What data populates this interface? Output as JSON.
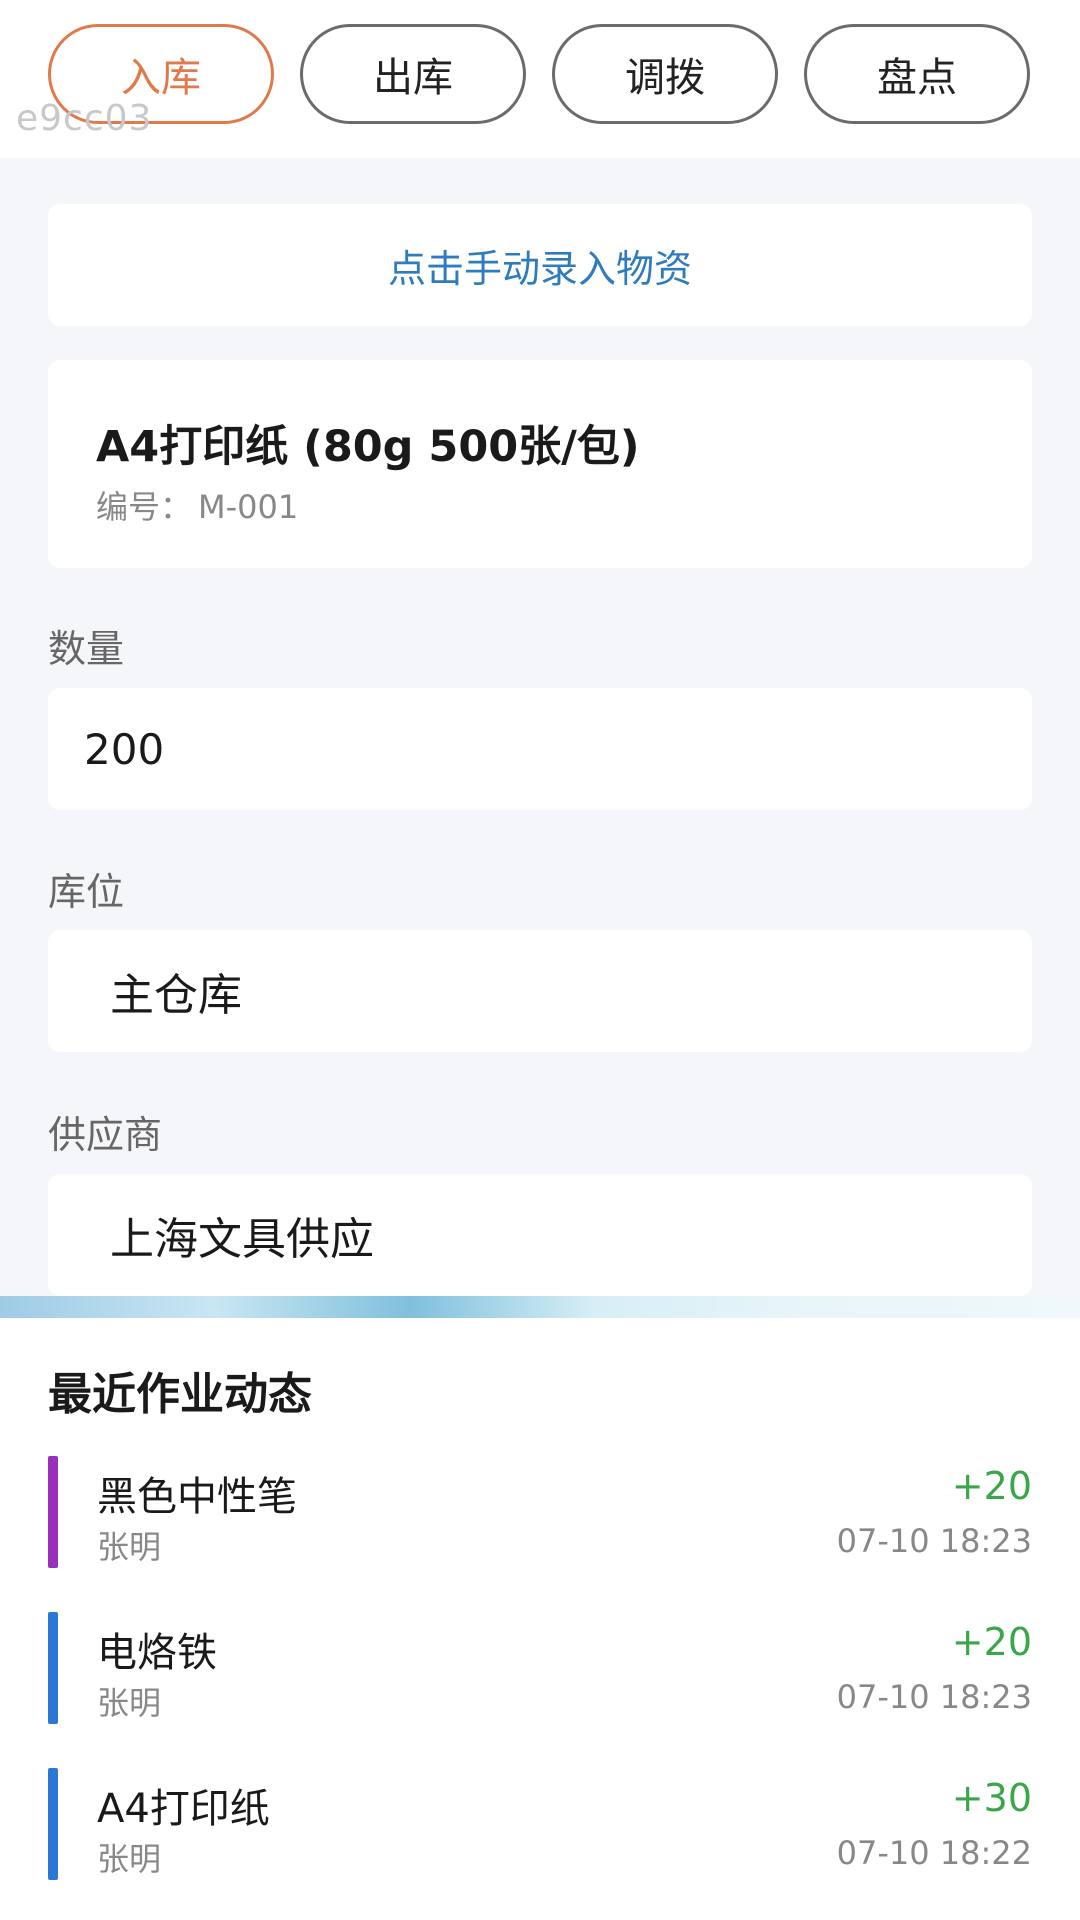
{
  "tabs": [
    {
      "label": "入库",
      "active": true
    },
    {
      "label": "出库",
      "active": false
    },
    {
      "label": "调拨",
      "active": false
    },
    {
      "label": "盘点",
      "active": false
    }
  ],
  "watermark": "e9cc03",
  "manual_entry": "点击手动录入物资",
  "item": {
    "name": "A4打印纸 (80g 500张/包)",
    "code_label": "编号：",
    "code": "M-001"
  },
  "fields": {
    "quantity": {
      "label": "数量",
      "value": "200"
    },
    "location": {
      "label": "库位",
      "value": "主仓库"
    },
    "supplier": {
      "label": "供应商",
      "value": "上海文具供应"
    }
  },
  "recent": {
    "title": "最近作业动态",
    "items": [
      {
        "name": "黑色中性笔",
        "user": "张明",
        "delta": "+20",
        "time": "07-10 18:23",
        "color": "#9b2fb8"
      },
      {
        "name": "电烙铁",
        "user": "张明",
        "delta": "+20",
        "time": "07-10 18:23",
        "color": "#2a78d4"
      },
      {
        "name": "A4打印纸",
        "user": "张明",
        "delta": "+30",
        "time": "07-10 18:22",
        "color": "#2a78d4"
      }
    ]
  },
  "colors": {
    "accent": "#e07a4a",
    "link": "#2f7bbf",
    "positive": "#3aa64a"
  }
}
